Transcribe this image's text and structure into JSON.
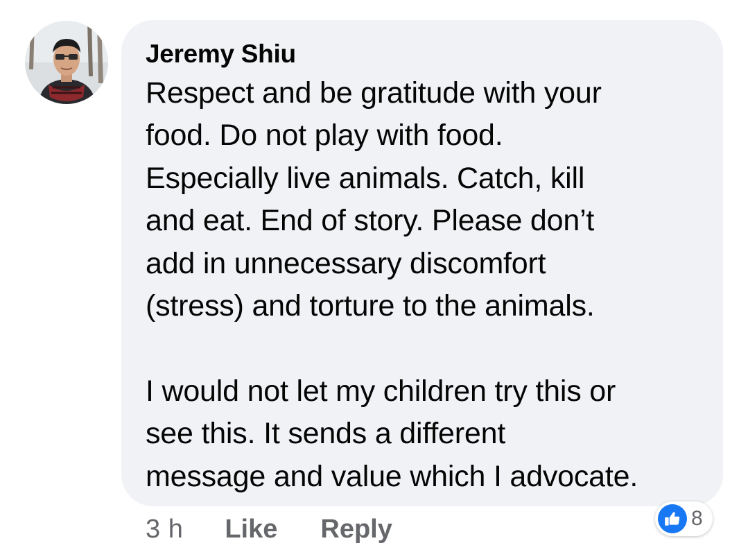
{
  "comment": {
    "author": "Jeremy Shiu",
    "paragraphs": [
      [
        "Respect and be gratitude with your",
        "food. Do not play with food.",
        "Especially live animals. Catch, kill",
        "and eat. End of story. Please don’t",
        "add in unnecessary discomfort",
        "(stress) and torture to the animals."
      ],
      [
        "I would not let my children try this or",
        "see this. It sends a different",
        "message and value which I advocate."
      ]
    ],
    "timestamp": "3 h",
    "like_label": "Like",
    "reply_label": "Reply",
    "reaction_icon": "thumbs-up-icon",
    "reaction_count": "8"
  },
  "colors": {
    "bubble": "#f0f2f5",
    "text": "#050505",
    "meta": "#65676b",
    "like_blue": "#1877f2"
  }
}
